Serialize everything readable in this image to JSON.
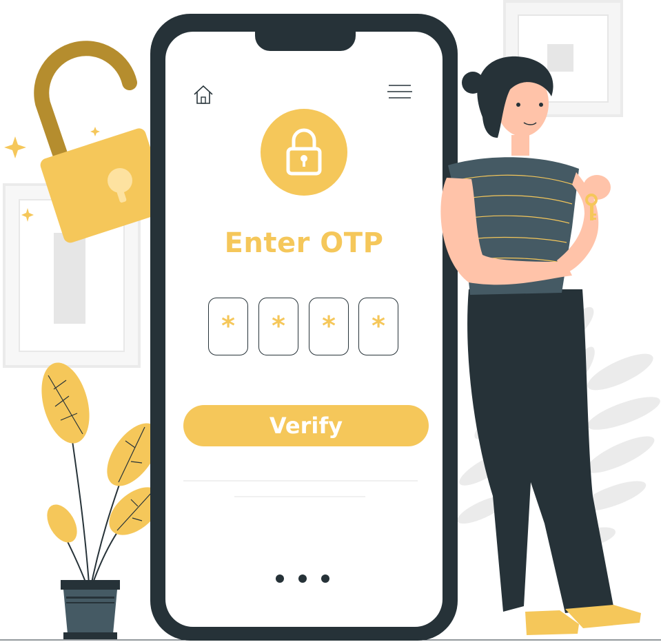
{
  "screen": {
    "title": "Enter OTP",
    "otp_digits": [
      "*",
      "*",
      "*",
      "*"
    ],
    "verify_label": "Verify",
    "home_icon": "home-icon",
    "menu_icon": "hamburger-menu-icon",
    "lock_icon": "padlock-icon",
    "page_indicator_count": 3
  },
  "colors": {
    "accent": "#F5C75A",
    "dark": "#263238",
    "gray_bg": "#EBEBEB",
    "shirt": "#455A64",
    "skin": "#FFC3A9",
    "hair": "#263238"
  }
}
